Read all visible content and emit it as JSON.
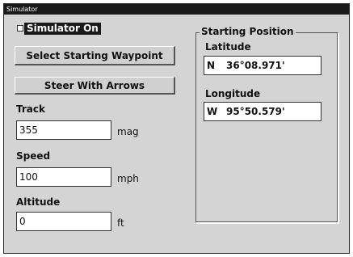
{
  "window": {
    "title": "Simulator"
  },
  "simulator": {
    "toggle_label": "Simulator On",
    "checked": false
  },
  "buttons": {
    "select_waypoint": "Select Starting Waypoint",
    "steer_arrows": "Steer With Arrows"
  },
  "track": {
    "label": "Track",
    "value": "355",
    "unit": "mag"
  },
  "speed": {
    "label": "Speed",
    "value": "100",
    "unit": "mph"
  },
  "altitude": {
    "label": "Altitude",
    "value": "0",
    "unit": "ft"
  },
  "starting_position": {
    "title": "Starting Position",
    "latitude": {
      "label": "Latitude",
      "hemisphere": "N",
      "value": "36°08.971'"
    },
    "longitude": {
      "label": "Longitude",
      "hemisphere": "W",
      "value": "95°50.579'"
    }
  }
}
